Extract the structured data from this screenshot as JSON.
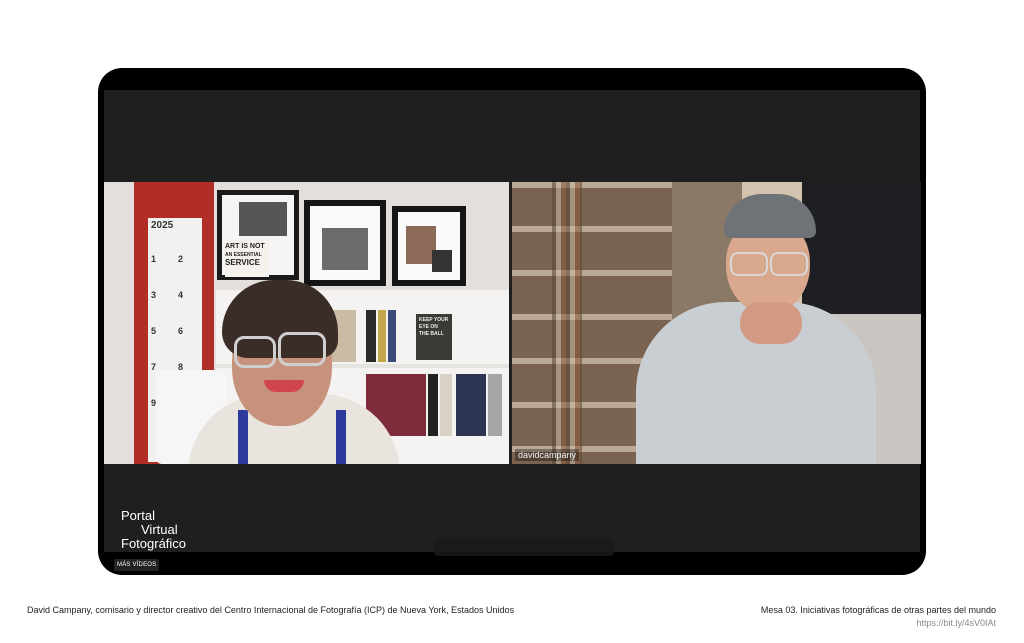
{
  "player": {
    "left_participant": {
      "photo": "woman-in-office"
    },
    "right_participant": {
      "name": "davidcampany",
      "photo": "man-in-library"
    },
    "calendar": {
      "year": "2025",
      "day_numbers": [
        "1",
        "2",
        "3",
        "4",
        "5",
        "6",
        "7",
        "8",
        "9"
      ]
    },
    "poster": {
      "line1": "ART IS NOT",
      "line2": "AN ESSENTIAL",
      "line3": "SERVICE"
    },
    "book_spine": "KEEP YOUR EYE ON THE BALL",
    "brand": {
      "line1": "Portal",
      "line2": "Virtual",
      "line3": "Fotográfico"
    },
    "more_videos_label": "MÁS VÍDEOS"
  },
  "captions": {
    "left": "David Campany, comisario y director creativo del Centro Internacional de Fotografía (ICP) de Nueva York, Estados Unidos",
    "right": "Mesa 03. Iniciativas fotográficas de otras partes del mundo",
    "link": "https://bit.ly/4sV0IAt"
  },
  "colors": {
    "page_bg": "#ffffff",
    "player_bg": "#000000",
    "stage_bg": "#1f1f20",
    "link": "#8a8a8a"
  }
}
